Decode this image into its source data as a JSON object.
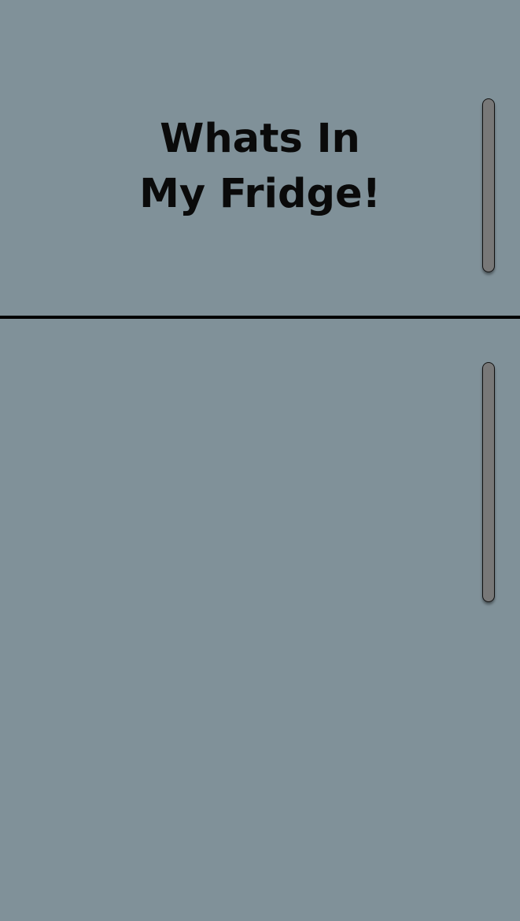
{
  "title": {
    "line1": "Whats In",
    "line2": "My Fridge!"
  },
  "colors": {
    "fridge_body": "#809199",
    "handle": "#787878",
    "divider": "#000000",
    "title_text": "#0a0a0a"
  }
}
